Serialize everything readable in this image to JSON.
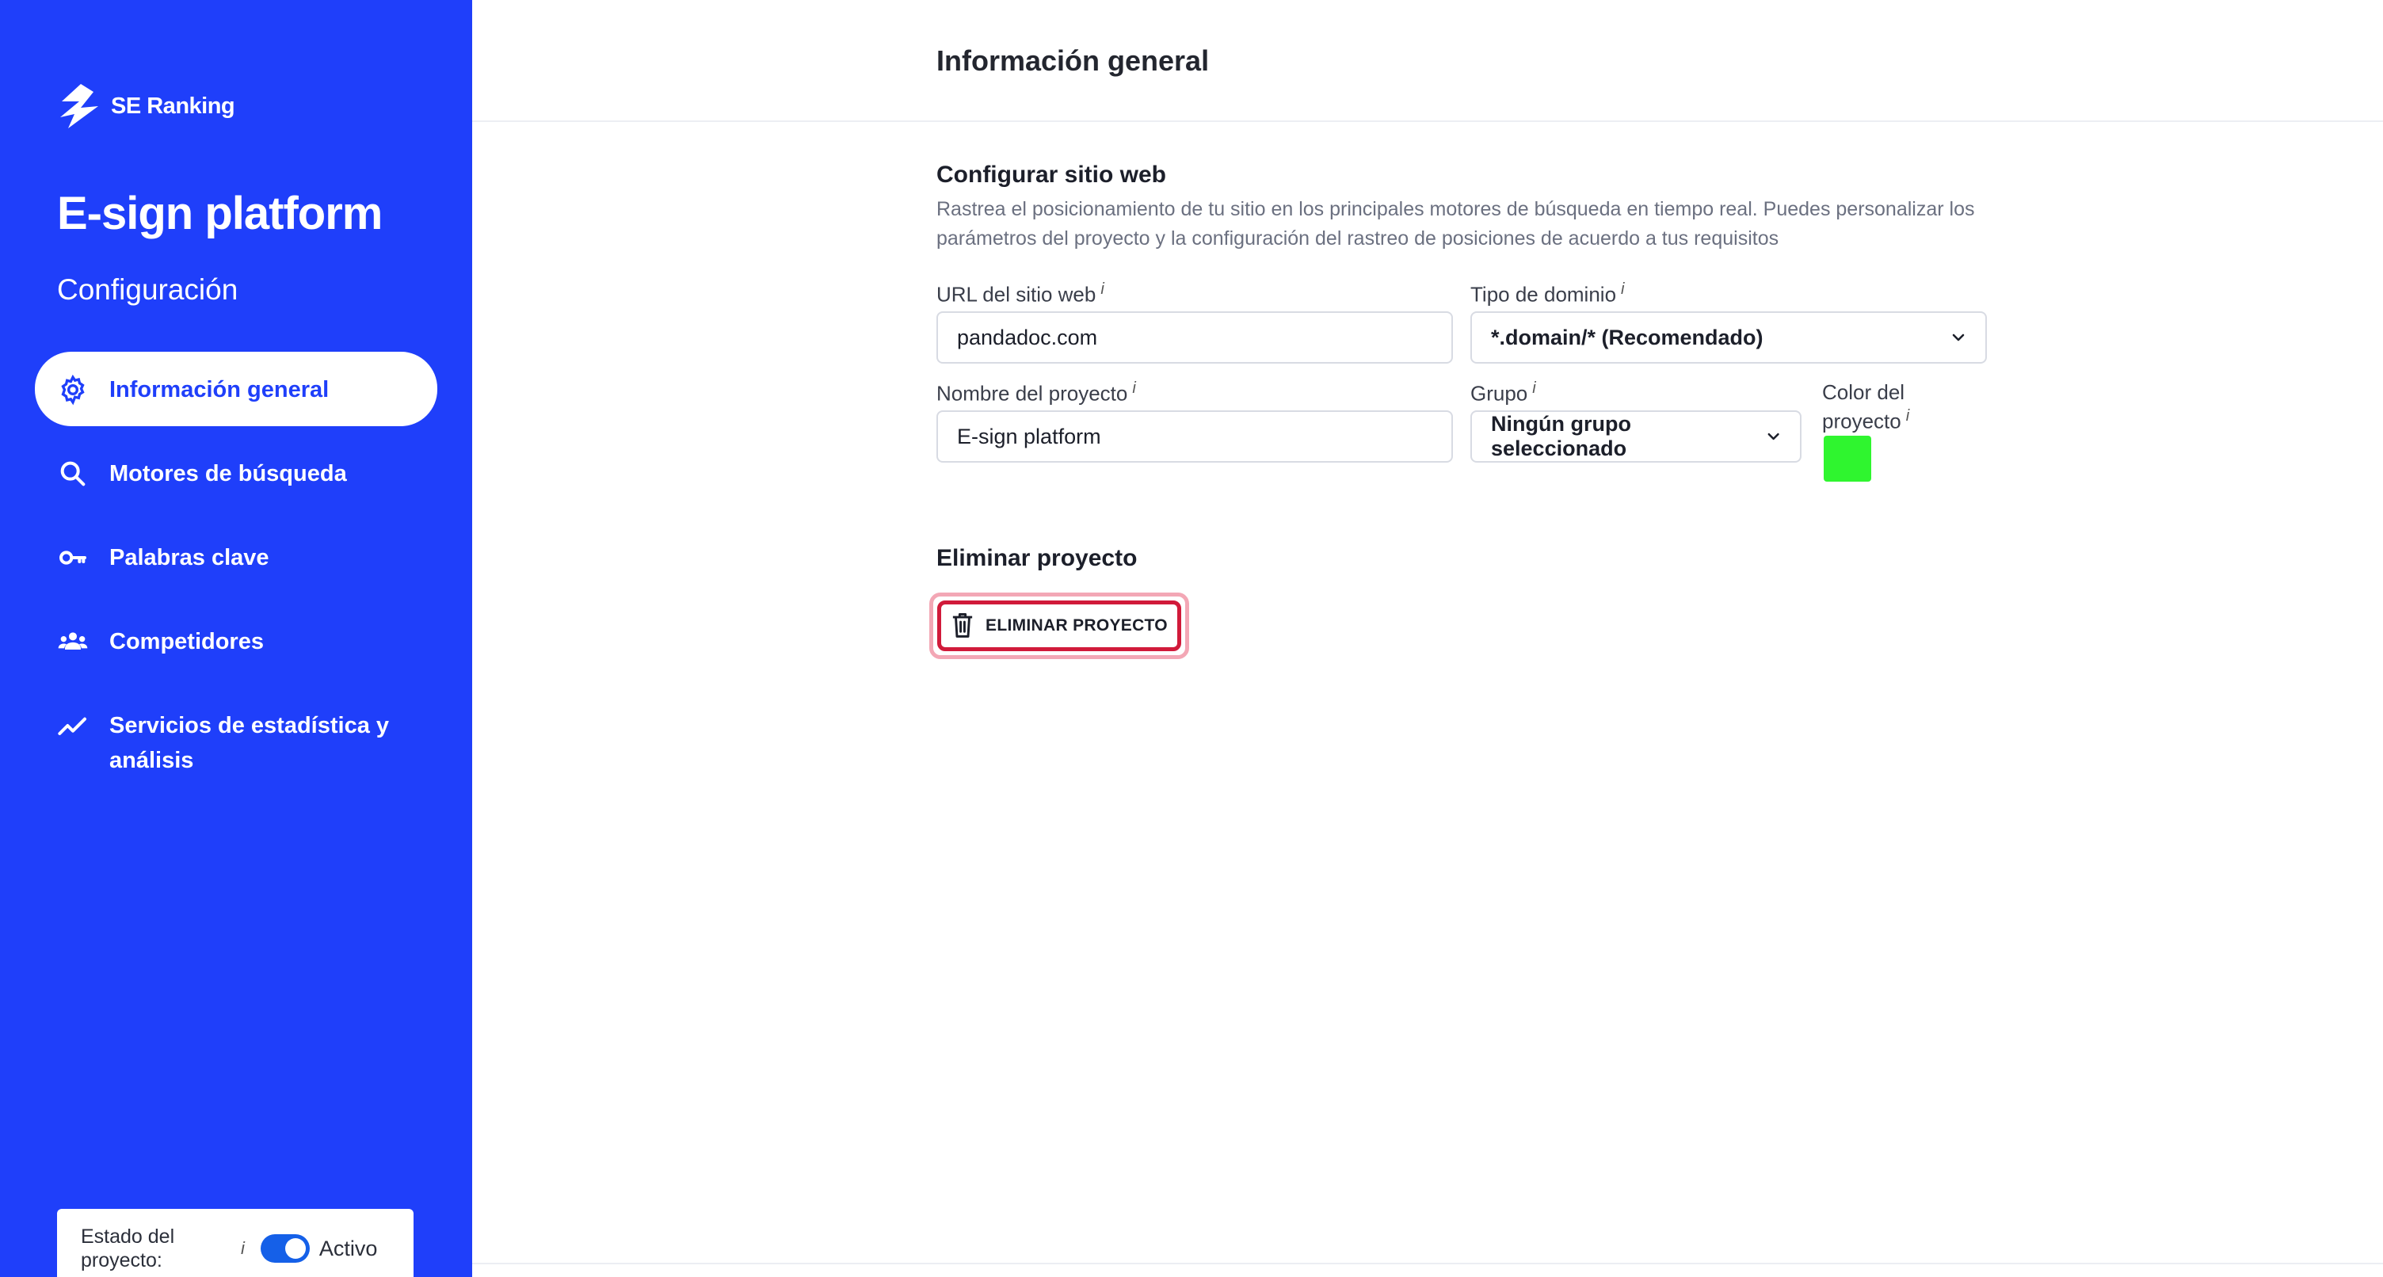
{
  "brand": {
    "name": "SE Ranking"
  },
  "project": {
    "title": "E-sign platform",
    "subtitle": "Configuración"
  },
  "sidebar": {
    "items": [
      {
        "label": "Información general",
        "icon": "gear-icon",
        "active": true
      },
      {
        "label": "Motores de búsqueda",
        "icon": "search-icon",
        "active": false
      },
      {
        "label": "Palabras clave",
        "icon": "key-icon",
        "active": false
      },
      {
        "label": "Competidores",
        "icon": "users-icon",
        "active": false
      },
      {
        "label": "Servicios de estadística y análisis",
        "icon": "trend-icon",
        "active": false
      }
    ],
    "status": {
      "label": "Estado del proyecto:",
      "info": "i",
      "value": "Activo"
    }
  },
  "main": {
    "page_title": "Información general",
    "configure": {
      "title": "Configurar sitio web",
      "description": "Rastrea el posicionamiento de tu sitio en los principales motores de búsqueda en tiempo real. Puedes personalizar los parámetros del proyecto y la configuración del rastreo de posiciones de acuerdo a tus requisitos"
    },
    "fields": {
      "url": {
        "label": "URL del sitio web",
        "value": "pandadoc.com"
      },
      "domain_type": {
        "label": "Tipo de dominio",
        "value": "*.domain/* (Recomendado)"
      },
      "project_name": {
        "label": "Nombre del proyecto",
        "value": "E-sign platform"
      },
      "group": {
        "label": "Grupo",
        "value": "Ningún grupo seleccionado"
      },
      "color": {
        "label": "Color del proyecto",
        "value": "#2ff52f"
      },
      "info_marker": "i"
    },
    "delete": {
      "title": "Eliminar proyecto",
      "button_label": "ELIMINAR PROYECTO"
    }
  },
  "colors": {
    "sidebar": "#1f3ffa",
    "danger": "#d11a3a",
    "toggle": "#1560e8"
  }
}
